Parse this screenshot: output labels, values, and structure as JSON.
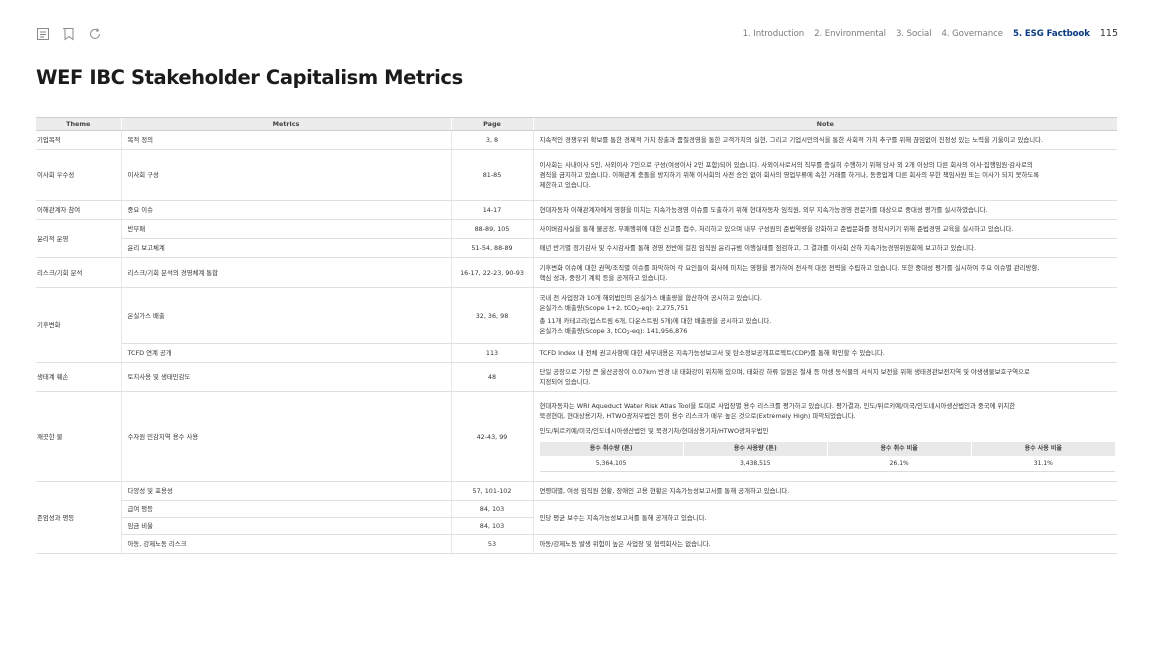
{
  "header": {
    "icons": [
      "list-icon",
      "bookmark-icon",
      "refresh-icon"
    ],
    "nav": [
      {
        "label": "1. Introduction",
        "active": false
      },
      {
        "label": "2. Environmental",
        "active": false
      },
      {
        "label": "3. Social",
        "active": false
      },
      {
        "label": "4. Governance",
        "active": false
      },
      {
        "label": "5. ESG Factbook",
        "active": true
      }
    ],
    "page_number": "115",
    "accent_color": "#0a3a82"
  },
  "title": "WEF IBC Stakeholder Capitalism Metrics",
  "table": {
    "headers": {
      "theme": "Theme",
      "metrics": "Metrics",
      "page": "Page",
      "note": "Note"
    },
    "rows": {
      "r1": {
        "theme": "기업목적",
        "metric": "목적 정의",
        "page": "3, 8",
        "note": "지속적인 경쟁우위 확보를 통한 경제적 가치 창출과 품질경영을 통한 고객가치의 실현, 그리고 기업시민의식을 통한 사회적 가치 추구를 위해 끊임없이 진정성 있는 노력을 기울이고 있습니다."
      },
      "r2": {
        "theme": "이사회 우수성",
        "metric": "이사회 구성",
        "page": "81-85",
        "note1": "이사회는 사내이사 5인, 사외이사 7인으로 구성(여성이사 2인 포함)되어 있습니다. 사외이사로서의 직무를 충실히 수행하기 위해 당사 외 2개 이상의 다른 회사의 이사·집행임원·감사로의",
        "note2": "겸직을 금지하고 있습니다. 이해관계 충돌을 방지하기 위해 이사회의 사전 승인 없이 회사의 영업부류에 속한 거래를 하거나, 동종업계 다른 회사의 무한 책임사원 또는 이사가 되지 못하도록",
        "note3": "제한하고 있습니다."
      },
      "r3": {
        "theme": "이해관계자 참여",
        "metric": "중요 이슈",
        "page": "14-17",
        "note": "현대자동차 이해관계자에게 영향을 미치는 지속가능경영 이슈를 도출하기 위해 현대자동차 임직원, 외부 지속가능경영 전문가를 대상으로 중대성 평가를 실시하였습니다."
      },
      "r4": {
        "theme": "윤리적 운영",
        "metric": "반부패",
        "page": "88-89, 105",
        "note": "사이버감사실을 통해 불공정, 부패행위에 대한 신고를 접수, 처리하고 있으며 내부 구성원의 준법역량을 강화하고 준법문화를 정착시키기 위해 준법경영 교육을 실시하고 있습니다."
      },
      "r5": {
        "metric": "윤리 보고체계",
        "page": "51-54, 88-89",
        "note": "매년 반기별 정기감사 및 수시감사를 통해 경영 전반에 걸친 임직원 윤리규범 이행실태를 점검하고, 그 결과를 이사회 산하 지속가능경영위원회에 보고하고 있습니다."
      },
      "r6": {
        "theme": "리스크/기회 분석",
        "metric": "리스크/기회 분석의 경영체계 통합",
        "page": "16-17, 22-23, 90-93",
        "note1": "기후변화 이슈에 대한 권역/조직별 이슈를 파악하여 각 요인들이 회사에 미치는 영향을 평가하여 전사적 대응 전략을 수립하고 있습니다. 또한 중대성 평가를 실시하여 주요 이슈별 관리방향,",
        "note2": "핵심 성과, 중장기 계획 등을 공개하고 있습니다."
      },
      "r7": {
        "theme": "기후변화",
        "metric": "온실가스 배출",
        "page": "32, 36, 98",
        "note1": "국내 전 사업장과 10개 해외법인의 온실가스 배출량을 합산하여 공시하고 있습니다.",
        "note2a": "온실가스 배출량(Scope 1+2, tCO",
        "note2s": "2",
        "note2b": "-eq): 2,275,751",
        "note3": "총 11개 카테고리(업스트림 6개, 다운스트림 5개)에 대한 배출량을 공시하고 있습니다.",
        "note4a": "온실가스 배출량(Scope 3, tCO",
        "note4s": "2",
        "note4b": "-eq): 141,956,876"
      },
      "r8": {
        "metric": "TCFD 연계 공개",
        "page": "113",
        "note": "TCFD Index 내 전체 권고사항에 대한 세부내용은 지속가능성보고서 및 탄소정보공개프로젝트(CDP)를 통해 확인할 수 있습니다."
      },
      "r9": {
        "theme": "생태계 훼손",
        "metric": "토지사용 및 생태민감도",
        "page": "48",
        "note1": "단일 공장으로 가장 큰 울산공장이 0.07km 반경 내 태화강이 위치해 있으며, 태화강 하류 일원은 철새 등 야생 동식물의 서식지 보전을 위해 생태경관보전지역 및 야생생물보호구역으로",
        "note2": "지정되어 있습니다."
      },
      "r10": {
        "theme": "깨끗한 물",
        "metric": "수자원 민감지역 용수 사용",
        "page": "42-43, 99",
        "note1": "현대자동차는 WRI Aqueduct Water Risk Atlas Tool을 토대로 사업장별 용수 리스크를 평가하고 있습니다.  평가결과, 인도/튀르키예/미국/인도네시아생산법인과 중국에 위치한",
        "note2": "북경현대, 현대상용기차, HTWO광저우법인 등이 용수 리스크가 매우 높은 것으로(Extremely High) 파악되었습니다.",
        "note3": "인도/튀르키예/미국/인도네시아생산법인 및 북경기차/현대상용기차/HTWO광저우법인",
        "inner_headers": [
          "용수 취수량 (톤)",
          "용수 사용량 (톤)",
          "용수 취수 비율",
          "용수 사용 비율"
        ],
        "inner_values": [
          "5,364,105",
          "3,438,515",
          "26.1%",
          "31.1%"
        ]
      },
      "r11": {
        "theme": "존엄성과 평등",
        "metric": "다양성 및 포용성",
        "page": "57, 101-102",
        "note": "연령대별, 여성 임직원 현황, 장애인 고용 현황은 지속가능성보고서를 통해 공개하고 있습니다."
      },
      "r12": {
        "metric": "급여 평등",
        "page": "84, 103",
        "note": "인당 평균 보수는 지속가능성보고서를 통해 공개하고 있습니다."
      },
      "r13": {
        "metric": "임금 비율",
        "page": "84, 103"
      },
      "r14": {
        "metric": "아동, 강제노동 리스크",
        "page": "53",
        "note": "아동/강제노동 발생 위험이 높은 사업장 및 협력회사는 없습니다."
      }
    }
  }
}
